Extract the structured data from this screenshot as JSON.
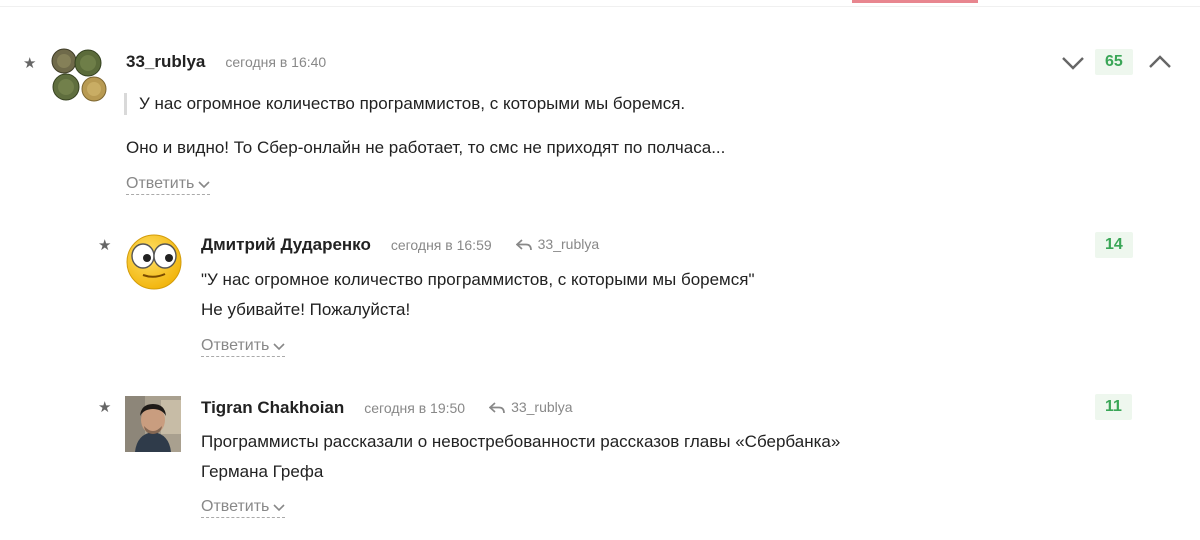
{
  "comments": [
    {
      "author": "33_rublya",
      "time": "сегодня в 16:40",
      "quote": "У нас огромное количество программистов, с которыми мы боремся.",
      "text": "Оно и видно! То Сбер-онлайн не работает, то смс не приходят по полчаса...",
      "reply_label": "Ответить",
      "rating": "65"
    },
    {
      "author": "Дмитрий Дударенко",
      "time": "сегодня в 16:59",
      "reply_to": "33_rublya",
      "lines": [
        "\"У нас огромное количество программистов, с которыми мы боремся\"",
        "Не убивайте! Пожалуйста!"
      ],
      "reply_label": "Ответить",
      "rating": "14"
    },
    {
      "author": "Tigran Chakhoian",
      "time": "сегодня в 19:50",
      "reply_to": "33_rublya",
      "lines": [
        "Программисты рассказали о невостребованности рассказов главы «Сбербанка»",
        "Германа Грефа"
      ],
      "reply_label": "Ответить",
      "rating": "11"
    }
  ],
  "colors": {
    "rating_text": "#3aa657",
    "rating_bg": "#eef7ee",
    "accent_bar": "#e8868f"
  },
  "icons": {
    "star": "★",
    "vote_down": "chevron-down-icon",
    "vote_up": "chevron-up-icon",
    "reply_arrow": "reply-arrow-icon"
  }
}
